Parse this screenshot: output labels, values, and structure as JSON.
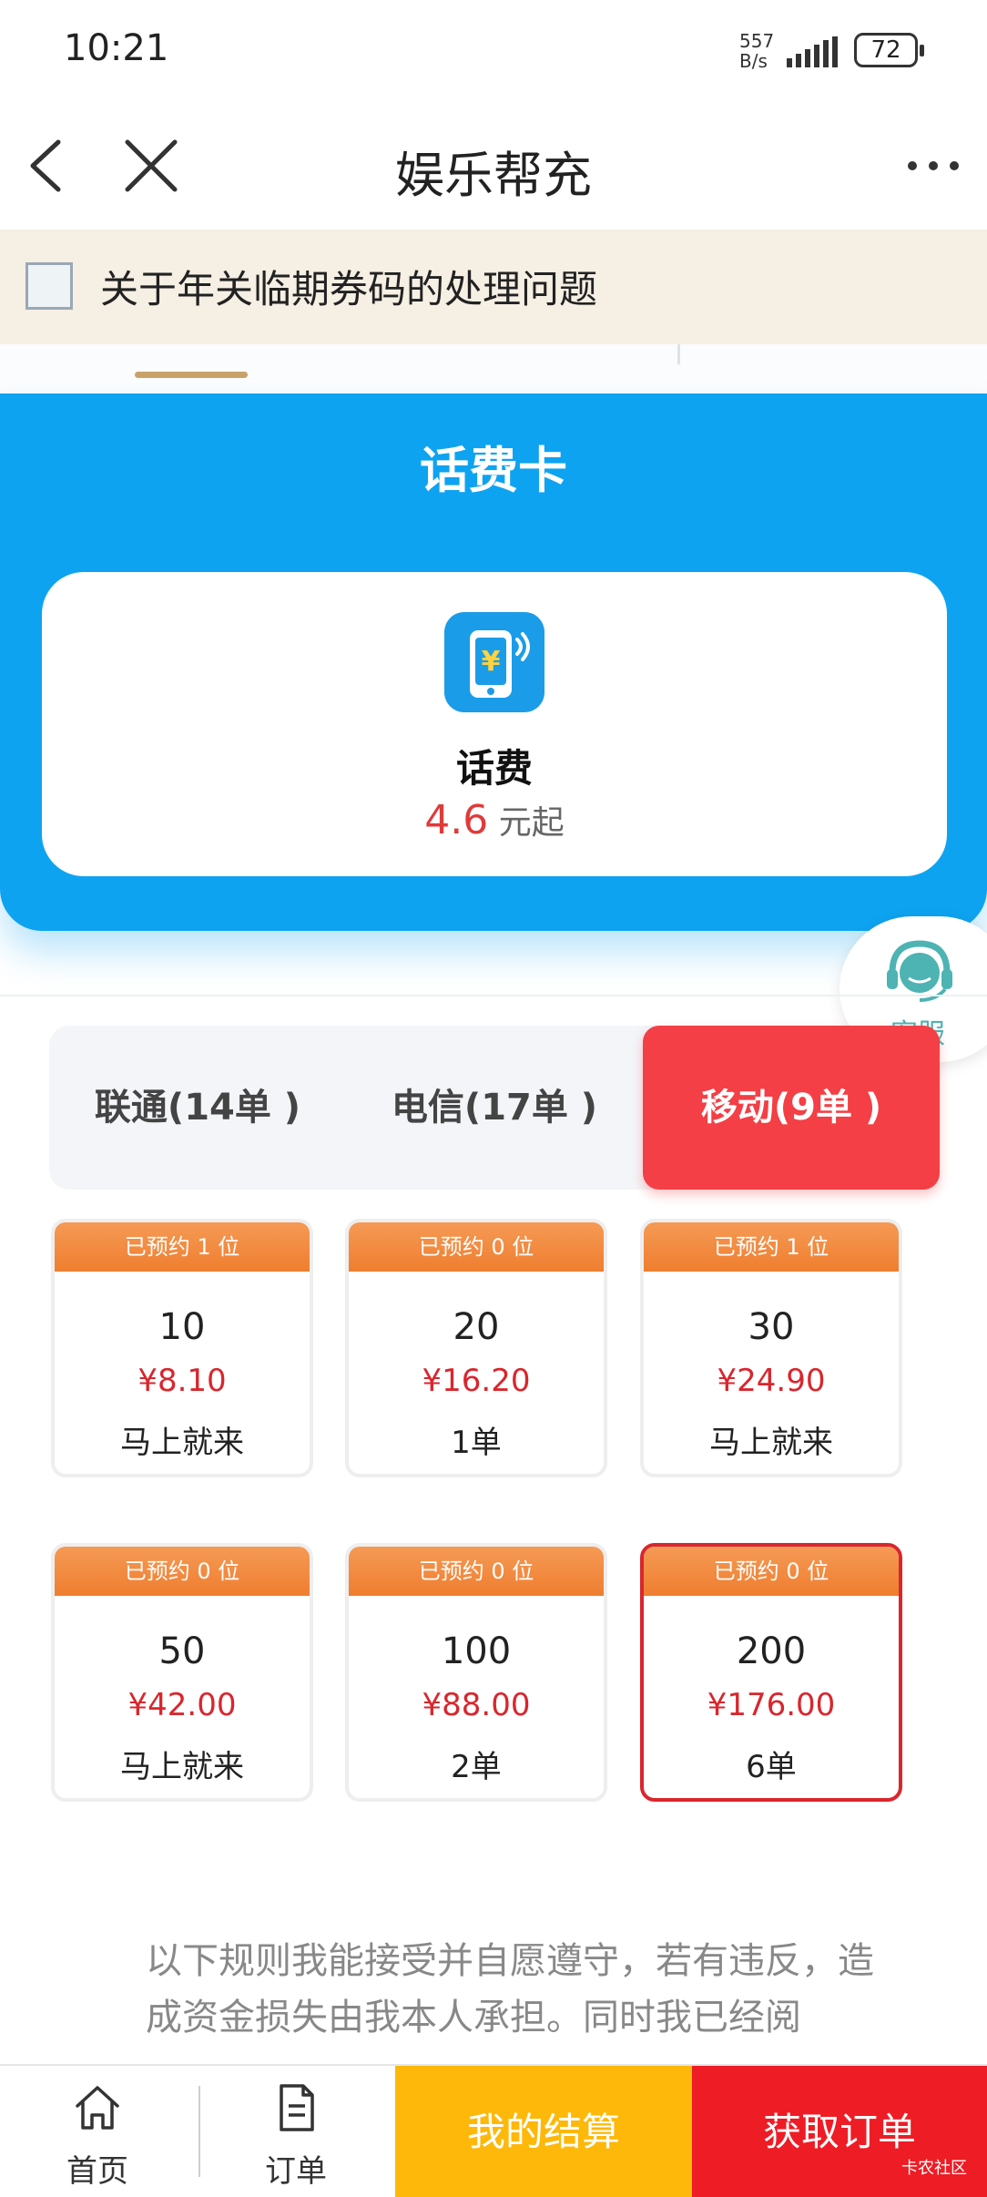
{
  "status": {
    "time": "10:21",
    "speed_top": "557",
    "speed_bottom": "B/s",
    "battery": "72"
  },
  "nav": {
    "title": "娱乐帮充"
  },
  "notice": {
    "text": "关于年关临期券码的处理问题"
  },
  "category": {
    "title": "话费卡",
    "item_name": "话费",
    "price_num": "4.6",
    "price_suffix": " 元起"
  },
  "service": {
    "label": "客服"
  },
  "carriers": [
    {
      "label": "联通(14单 )",
      "active": false
    },
    {
      "label": "电信(17单 )",
      "active": false
    },
    {
      "label": "移动(9单 )",
      "active": true
    }
  ],
  "products": [
    {
      "ribbon": "已预约 1 位",
      "face": "10",
      "price": "¥8.10",
      "note": "马上就来",
      "selected": false
    },
    {
      "ribbon": "已预约 0 位",
      "face": "20",
      "price": "¥16.20",
      "note": "1单",
      "selected": false
    },
    {
      "ribbon": "已预约 1 位",
      "face": "30",
      "price": "¥24.90",
      "note": "马上就来",
      "selected": false
    },
    {
      "ribbon": "已预约 0 位",
      "face": "50",
      "price": "¥42.00",
      "note": "马上就来",
      "selected": false
    },
    {
      "ribbon": "已预约 0 位",
      "face": "100",
      "price": "¥88.00",
      "note": "2单",
      "selected": false
    },
    {
      "ribbon": "已预约 0 位",
      "face": "200",
      "price": "¥176.00",
      "note": "6单",
      "selected": true
    }
  ],
  "rules": {
    "text": "以下规则我能接受并自愿遵守，若有违反，造成资金损失由我本人承担。同时我已经阅"
  },
  "bottom": {
    "home": "首页",
    "orders": "订单",
    "settle": "我的结算",
    "get_order": "获取订单"
  },
  "watermark": "卡农社区",
  "colors": {
    "blue": "#0ea3f0",
    "red": "#f33f45",
    "orange": "#ef7e2f",
    "yellow": "#fdb809"
  }
}
